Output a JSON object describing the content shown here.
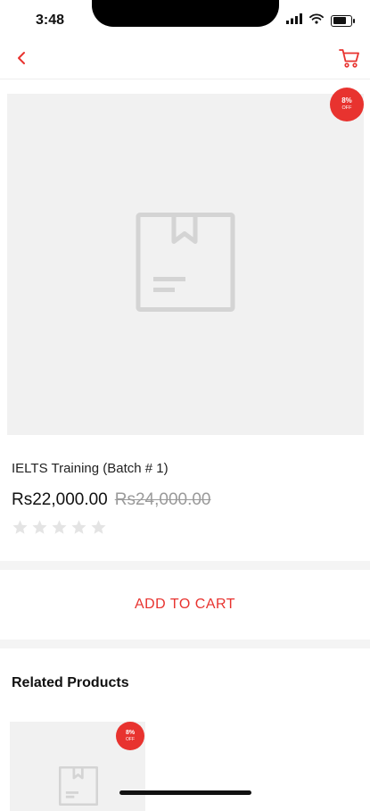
{
  "status_bar": {
    "time": "3:48",
    "icons": [
      "signal-icon",
      "wifi-icon",
      "battery-icon"
    ],
    "battery_level": 0.85
  },
  "nav": {
    "back_icon": "chevron-left-icon",
    "cart_icon": "cart-icon"
  },
  "product": {
    "discount_percent": "8%",
    "discount_suffix": "OFF",
    "placeholder_icon": "package-placeholder-icon",
    "title": "IELTS Training (Batch # 1)",
    "price": "Rs22,000.00",
    "original_price": "Rs24,000.00",
    "rating": 0,
    "rating_max": 5
  },
  "actions": {
    "add_to_cart_label": "ADD TO CART"
  },
  "related": {
    "heading": "Related Products",
    "items": [
      {
        "discount_percent": "8%",
        "discount_suffix": "OFF"
      }
    ]
  },
  "colors": {
    "accent": "#e8332f",
    "image_background": "#f1f1f1",
    "star_empty": "#e4e4e4",
    "old_price": "#9a9a9a"
  }
}
